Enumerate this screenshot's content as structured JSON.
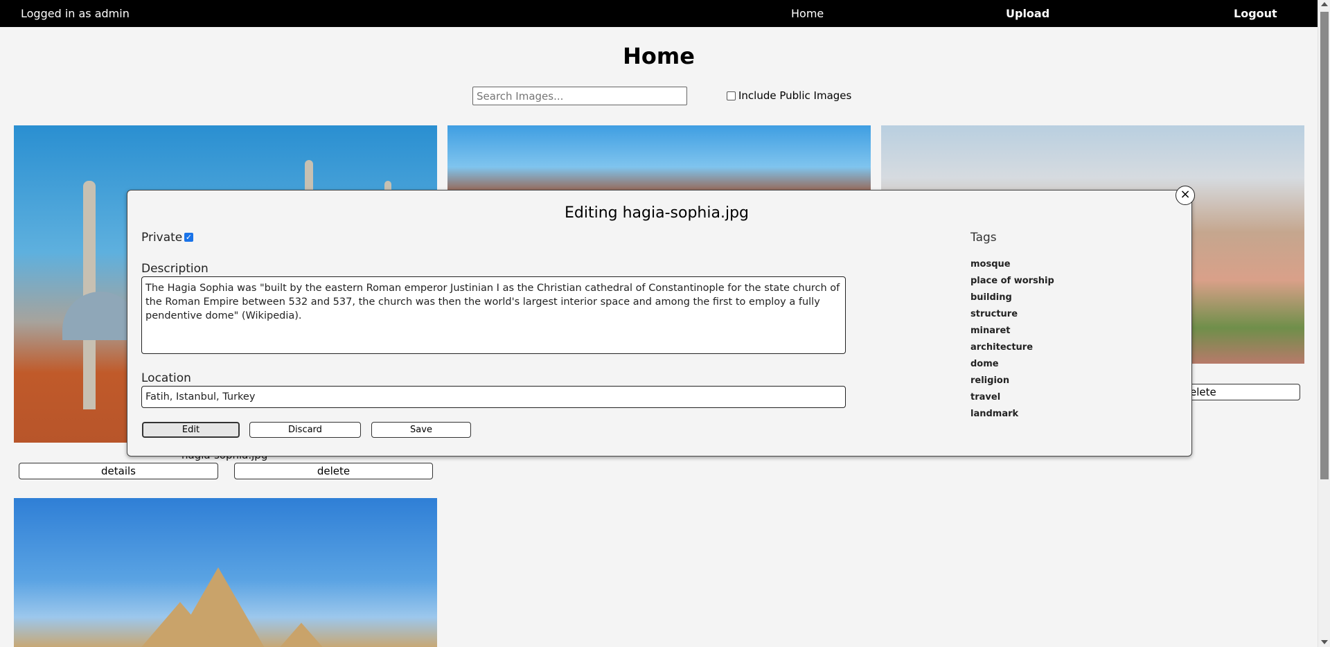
{
  "topbar": {
    "user_status": "Logged in as admin",
    "nav": {
      "home": "Home",
      "upload": "Upload",
      "logout": "Logout"
    }
  },
  "page": {
    "title": "Home",
    "search_placeholder": "Search Images...",
    "include_public_label": "Include Public Images"
  },
  "gallery": {
    "cards": [
      {
        "caption": "hagia-sophia.jpg",
        "details_label": "details",
        "delete_label": "delete"
      },
      {
        "caption": "",
        "details_label": "",
        "delete_label": ""
      },
      {
        "caption": "",
        "details_label": "",
        "delete_label": "elete"
      },
      {
        "caption": "",
        "details_label": "",
        "delete_label": ""
      }
    ]
  },
  "modal": {
    "title": "Editing hagia-sophia.jpg",
    "close_symbol": "×",
    "private_label": "Private",
    "private_checked": true,
    "description_label": "Description",
    "description_value": "The Hagia Sophia was \"built by the eastern Roman emperor Justinian I as the Christian cathedral of Constantinople for the state church of the Roman Empire between 532 and 537, the church was then the world's largest interior space and among the first to employ a fully pendentive dome\" (Wikipedia).",
    "location_label": "Location",
    "location_value": "Fatih, Istanbul, Turkey",
    "buttons": {
      "edit": "Edit",
      "discard": "Discard",
      "save": "Save"
    },
    "tags_label": "Tags",
    "tags": [
      "mosque",
      "place of worship",
      "building",
      "structure",
      "minaret",
      "architecture",
      "dome",
      "religion",
      "travel",
      "landmark"
    ]
  },
  "colors": {
    "nav_bg": "#000000",
    "checkbox_accent": "#1a73e8",
    "page_bg": "#f4f4f4"
  }
}
